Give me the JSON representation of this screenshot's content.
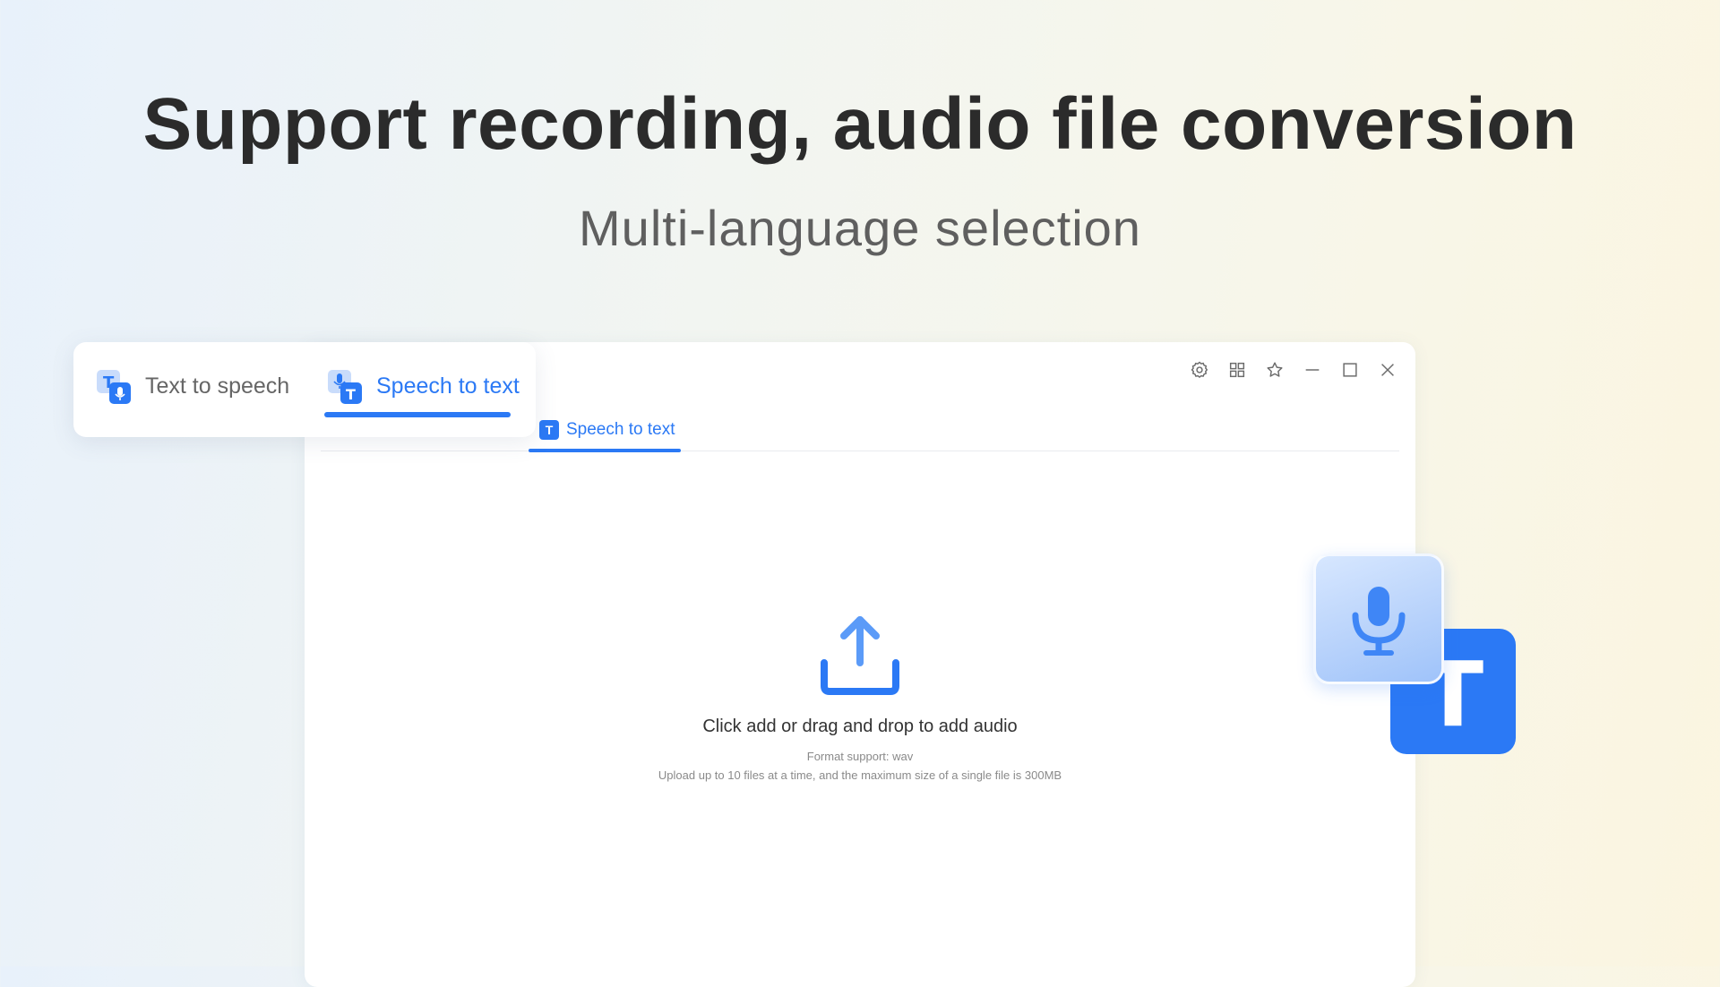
{
  "hero": {
    "title": "Support recording, audio file conversion",
    "subtitle": "Multi-language selection"
  },
  "tab_card": {
    "tabs": [
      {
        "label": "Text to speech",
        "icon": "text-to-speech-icon",
        "active": false
      },
      {
        "label": "Speech to text",
        "icon": "speech-to-text-icon",
        "active": true
      }
    ]
  },
  "window": {
    "controls": [
      "gear-icon",
      "grid-icon",
      "star-icon",
      "minimize-icon",
      "maximize-icon",
      "close-icon"
    ],
    "active_tab": {
      "label": "Speech to text",
      "icon_letter": "T"
    },
    "upload": {
      "main_text": "Click add  or drag and drop to add audio",
      "format_text": "Format support: wav",
      "limit_text": "Upload up to 10 files at a time, and the maximum size of a single file is 300MB"
    }
  },
  "big_icon": {
    "letter": "T"
  },
  "colors": {
    "accent": "#2b79f5",
    "accent_light": "#b9d3fb",
    "title": "#2b2b2b",
    "subtitle": "#5f5f5f",
    "muted_text": "#8a8a8a"
  }
}
